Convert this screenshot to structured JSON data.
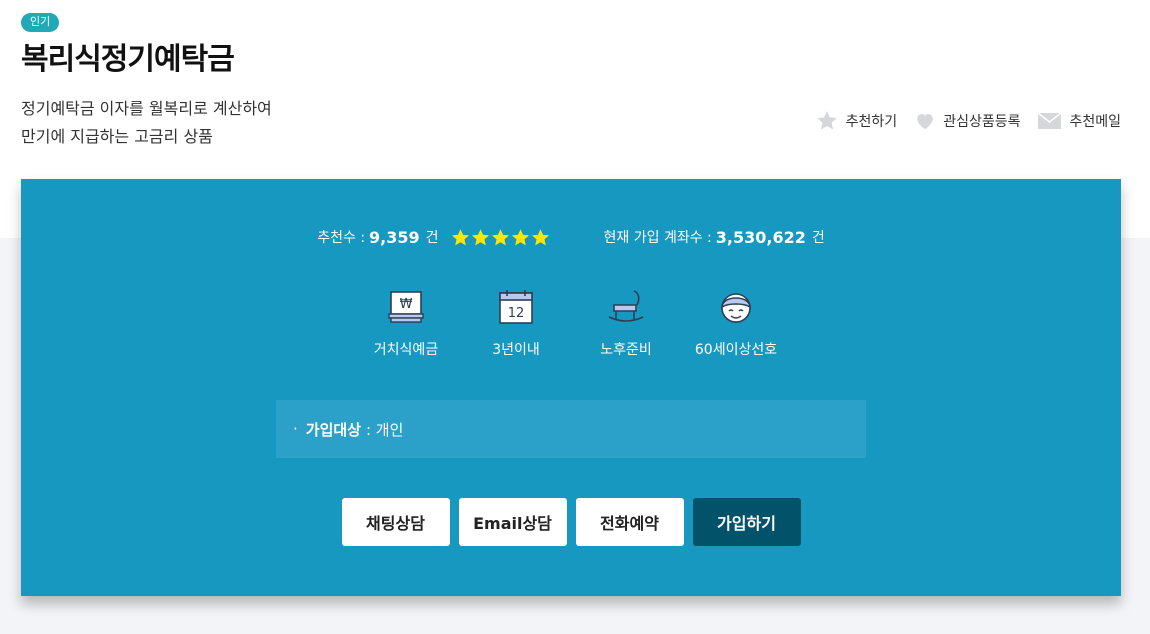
{
  "header": {
    "badge": "인기",
    "title": "복리식정기예탁금",
    "desc_line1": "정기예탁금 이자를 월복리로 계산하여",
    "desc_line2": "만기에 지급하는 고금리 상품"
  },
  "actions": {
    "recommend": "추천하기",
    "favorite": "관심상품등록",
    "email": "추천메일"
  },
  "stats": {
    "recommend_label": "추천수 :",
    "recommend_count": "9,359",
    "recommend_unit": "건",
    "rating": 5,
    "accounts_label": "현재 가입 계좌수 :",
    "accounts_count": "3,530,622",
    "accounts_unit": "건"
  },
  "features": [
    {
      "label": "거치식예금",
      "icon": "won-bill-icon"
    },
    {
      "label": "3년이내",
      "icon": "calendar-icon",
      "calendar_number": "12"
    },
    {
      "label": "노후준비",
      "icon": "rocking-chair-icon"
    },
    {
      "label": "60세이상선호",
      "icon": "senior-face-icon"
    }
  ],
  "target": {
    "bullet": "·",
    "label": "가입대상",
    "value": ": 개인"
  },
  "buttons": {
    "chat": "채팅상담",
    "email": "Email상담",
    "phone": "전화예약",
    "join": "가입하기"
  },
  "colors": {
    "card_bg": "#1798c1",
    "badge_bg": "#21aab5",
    "star": "#ffe600",
    "primary_button": "#02526a"
  }
}
